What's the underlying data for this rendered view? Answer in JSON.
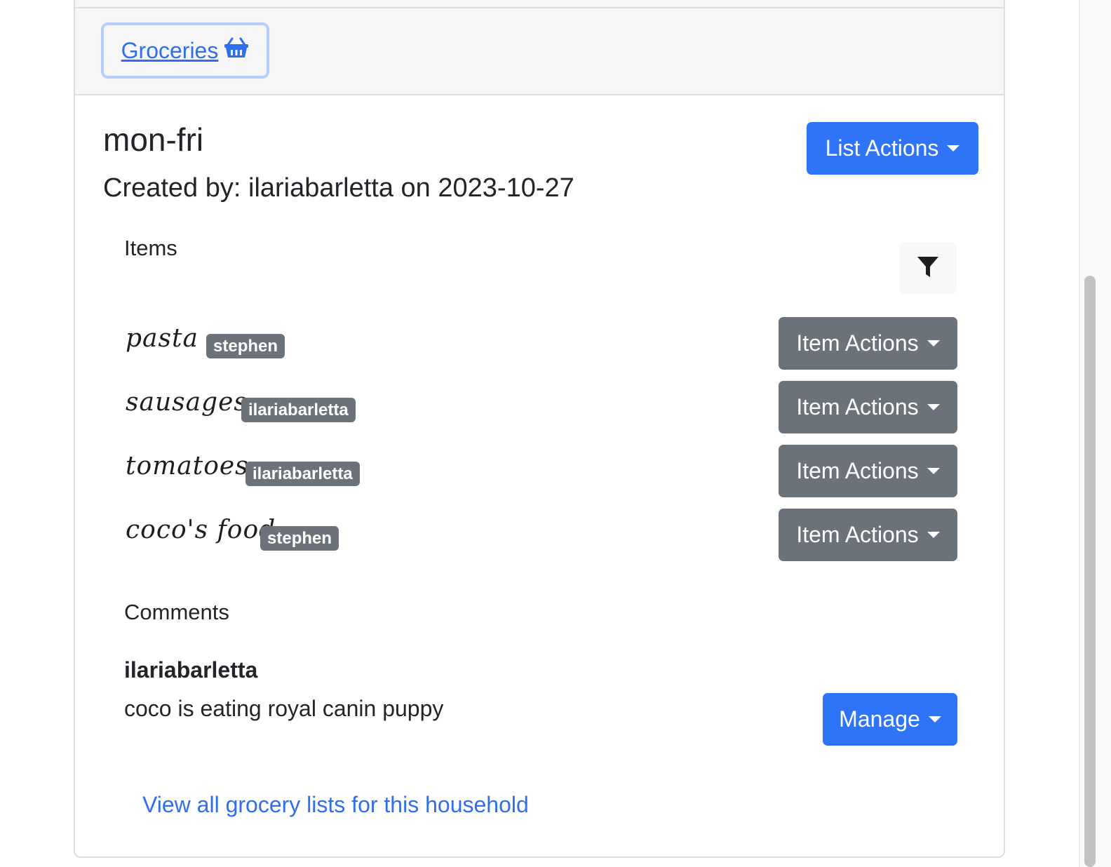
{
  "header": {
    "tab_label": "Groceries",
    "tab_icon": "basket-icon"
  },
  "list": {
    "title": "mon-fri",
    "created_by": "Created by: ilariabarletta on 2023-10-27",
    "list_actions_label": "List Actions"
  },
  "items_section": {
    "label": "Items",
    "filter_icon": "filter-icon",
    "items": [
      {
        "name": "pasta",
        "user": "stephen",
        "actions_label": "Item Actions"
      },
      {
        "name": "sausages",
        "user": "ilariabarletta",
        "actions_label": "Item Actions"
      },
      {
        "name": "tomatoes",
        "user": "ilariabarletta",
        "actions_label": "Item Actions"
      },
      {
        "name": "coco's food",
        "user": "stephen",
        "actions_label": "Item Actions"
      }
    ]
  },
  "comments_section": {
    "label": "Comments",
    "comments": [
      {
        "author": "ilariabarletta",
        "text": "coco is eating royal canin puppy",
        "manage_label": "Manage"
      }
    ]
  },
  "footer": {
    "view_all_link": "View all grocery lists for this household"
  },
  "colors": {
    "primary": "#2f74f6",
    "secondary": "#6b7279",
    "link": "#2f6fed"
  }
}
